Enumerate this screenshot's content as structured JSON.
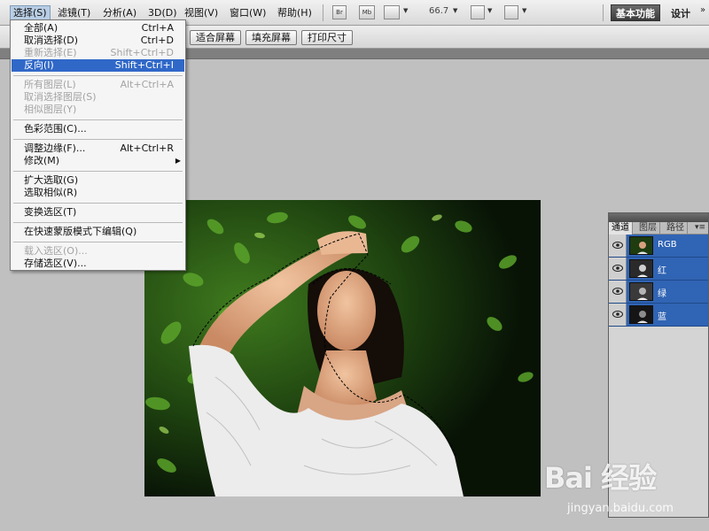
{
  "menubar": {
    "items": [
      {
        "label": "选择(S)"
      },
      {
        "label": "滤镜(T)"
      },
      {
        "label": "分析(A)"
      },
      {
        "label": "3D(D)"
      },
      {
        "label": "视图(V)"
      },
      {
        "label": "窗口(W)"
      },
      {
        "label": "帮助(H)"
      }
    ],
    "icons": {
      "br": "Br",
      "mb": "Mb"
    },
    "zoom": "66.7",
    "workspace_basic": "基本功能",
    "workspace_design": "设计",
    "more": "»"
  },
  "options_bar": {
    "fit_screen": "适合屏幕",
    "fill_screen": "填充屏幕",
    "print_size": "打印尺寸"
  },
  "select_menu": {
    "items": [
      {
        "label": "全部(A)",
        "shortcut": "Ctrl+A",
        "enabled": true
      },
      {
        "label": "取消选择(D)",
        "shortcut": "Ctrl+D",
        "enabled": true
      },
      {
        "label": "重新选择(E)",
        "shortcut": "Shift+Ctrl+D",
        "enabled": false
      },
      {
        "label": "反向(I)",
        "shortcut": "Shift+Ctrl+I",
        "enabled": true,
        "highlighted": true
      },
      {
        "label": "所有图层(L)",
        "shortcut": "Alt+Ctrl+A",
        "enabled": false
      },
      {
        "label": "取消选择图层(S)",
        "shortcut": "",
        "enabled": false
      },
      {
        "label": "相似图层(Y)",
        "shortcut": "",
        "enabled": false
      },
      {
        "label": "色彩范围(C)...",
        "shortcut": "",
        "enabled": true
      },
      {
        "label": "调整边缘(F)...",
        "shortcut": "Alt+Ctrl+R",
        "enabled": true
      },
      {
        "label": "修改(M)",
        "shortcut": "",
        "enabled": true,
        "submenu": "▶"
      },
      {
        "label": "扩大选取(G)",
        "shortcut": "",
        "enabled": true
      },
      {
        "label": "选取相似(R)",
        "shortcut": "",
        "enabled": true
      },
      {
        "label": "变换选区(T)",
        "shortcut": "",
        "enabled": true
      },
      {
        "label": "在快速蒙版模式下编辑(Q)",
        "shortcut": "",
        "enabled": true
      },
      {
        "label": "载入选区(O)...",
        "shortcut": "",
        "enabled": false
      },
      {
        "label": "存储选区(V)...",
        "shortcut": "",
        "enabled": true
      }
    ]
  },
  "channels_panel": {
    "tabs": [
      {
        "label": "通道",
        "active": true
      },
      {
        "label": "图层",
        "active": false
      },
      {
        "label": "路径",
        "active": false
      }
    ],
    "menu_icon": "▾≡",
    "channels": [
      {
        "name": "RGB"
      },
      {
        "name": "红"
      },
      {
        "name": "绿"
      },
      {
        "name": "蓝"
      }
    ]
  },
  "watermark": {
    "logo": "Bai 经验",
    "site": "jingyan.baidu.com"
  },
  "colors": {
    "menu_highlight": "#3068c8",
    "channel_row": "#3064b4"
  }
}
